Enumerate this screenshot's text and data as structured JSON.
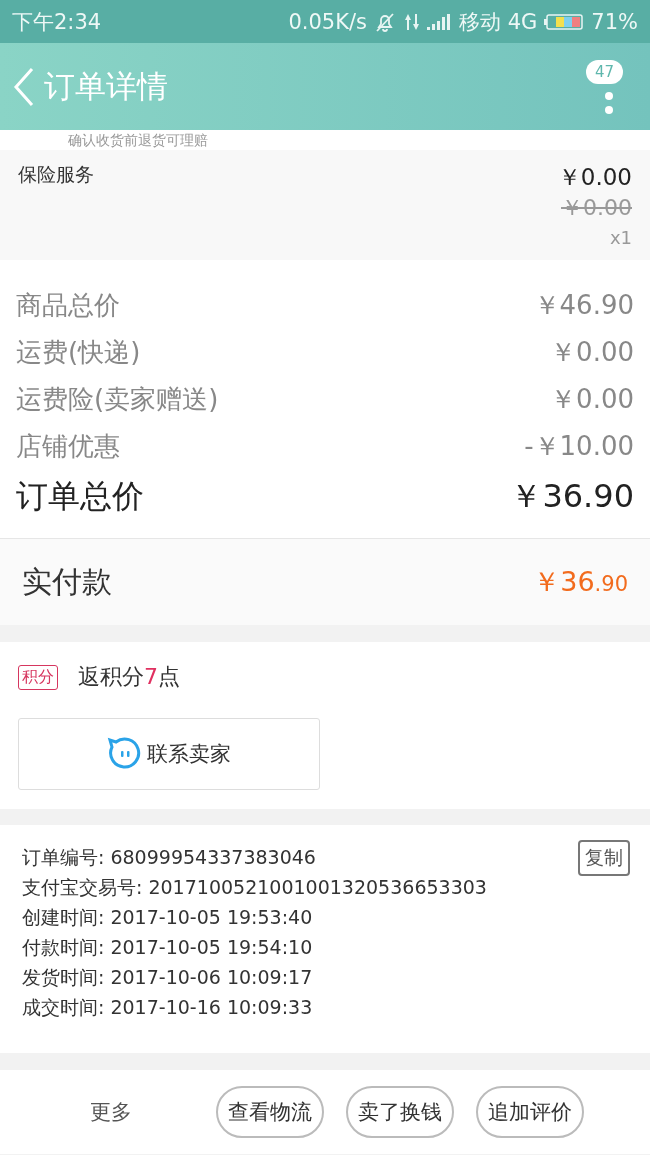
{
  "status_bar": {
    "time": "下午2:34",
    "speed": "0.05K/s",
    "carrier": "移动 4G",
    "battery": "71%"
  },
  "header": {
    "title": "订单详情",
    "badge": "47"
  },
  "notice": "确认收货前退货可理赔",
  "insurance": {
    "label": "保险服务",
    "price": "￥0.00",
    "original_price": "￥0.00",
    "quantity": "x1"
  },
  "price_lines": [
    {
      "label": "商品总价",
      "value": "￥46.90",
      "kind": "normal"
    },
    {
      "label": "运费(快递)",
      "value": "￥0.00",
      "kind": "normal"
    },
    {
      "label": "运费险(卖家赠送)",
      "value": "￥0.00",
      "kind": "normal"
    },
    {
      "label": "店铺优惠",
      "value": "-￥10.00",
      "kind": "normal"
    },
    {
      "label": "订单总价",
      "value": "￥36.90",
      "kind": "total"
    }
  ],
  "payment": {
    "label": "实付款",
    "amount_main": "￥36",
    "amount_decimal": ".90"
  },
  "points": {
    "tag": "积分",
    "prefix": "返积分",
    "number": "7",
    "suffix": "点"
  },
  "contact_button": "联系卖家",
  "order_info": {
    "copy_button": "复制",
    "lines": [
      "订单编号: 68099954337383046",
      "支付宝交易号: 2017100521001001320536653303",
      "创建时间: 2017-10-05 19:53:40",
      "付款时间: 2017-10-05 19:54:10",
      "发货时间: 2017-10-06 10:09:17",
      "成交时间: 2017-10-16 10:09:33"
    ]
  },
  "bottom_bar": {
    "more": "更多",
    "buttons": [
      "查看物流",
      "卖了换钱",
      "追加评价"
    ]
  }
}
